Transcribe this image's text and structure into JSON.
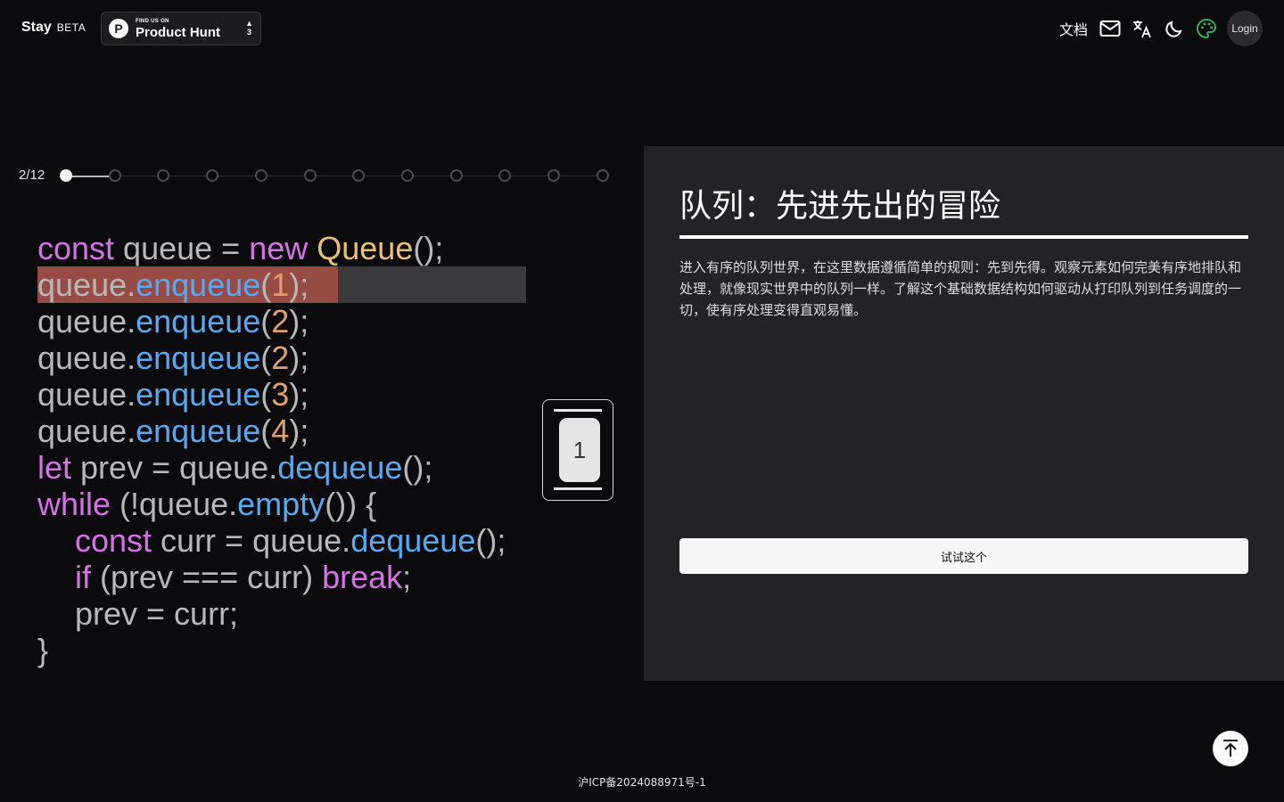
{
  "header": {
    "brand": "Stay",
    "beta": "BETA",
    "product_hunt": {
      "small": "FIND US ON",
      "big": "Product Hunt",
      "votes": "3"
    },
    "nav": {
      "docs": "文档",
      "login": "Login"
    }
  },
  "progress": {
    "label": "2/12",
    "current": 2,
    "total": 12
  },
  "code": {
    "lines": [
      [
        {
          "t": "const",
          "c": "kw"
        },
        {
          "t": " queue = ",
          "c": ""
        },
        {
          "t": "new",
          "c": "kw"
        },
        {
          "t": " ",
          "c": ""
        },
        {
          "t": "Queue",
          "c": "cls"
        },
        {
          "t": "();",
          "c": ""
        }
      ],
      [
        {
          "t": "queue.",
          "c": ""
        },
        {
          "t": "enqueue",
          "c": "fn"
        },
        {
          "t": "(",
          "c": ""
        },
        {
          "t": "1",
          "c": "num"
        },
        {
          "t": ");",
          "c": ""
        }
      ],
      [
        {
          "t": "queue.",
          "c": ""
        },
        {
          "t": "enqueue",
          "c": "fn"
        },
        {
          "t": "(",
          "c": ""
        },
        {
          "t": "2",
          "c": "num"
        },
        {
          "t": ");",
          "c": ""
        }
      ],
      [
        {
          "t": "queue.",
          "c": ""
        },
        {
          "t": "enqueue",
          "c": "fn"
        },
        {
          "t": "(",
          "c": ""
        },
        {
          "t": "2",
          "c": "num"
        },
        {
          "t": ");",
          "c": ""
        }
      ],
      [
        {
          "t": "queue.",
          "c": ""
        },
        {
          "t": "enqueue",
          "c": "fn"
        },
        {
          "t": "(",
          "c": ""
        },
        {
          "t": "3",
          "c": "num"
        },
        {
          "t": ");",
          "c": ""
        }
      ],
      [
        {
          "t": "queue.",
          "c": ""
        },
        {
          "t": "enqueue",
          "c": "fn"
        },
        {
          "t": "(",
          "c": ""
        },
        {
          "t": "4",
          "c": "num"
        },
        {
          "t": ");",
          "c": ""
        }
      ],
      [
        {
          "t": "let",
          "c": "kw"
        },
        {
          "t": " prev = queue.",
          "c": ""
        },
        {
          "t": "dequeue",
          "c": "fn"
        },
        {
          "t": "();",
          "c": ""
        }
      ],
      [
        {
          "t": "while",
          "c": "kw"
        },
        {
          "t": " (!queue.",
          "c": ""
        },
        {
          "t": "empty",
          "c": "fn"
        },
        {
          "t": "()) {",
          "c": ""
        }
      ],
      [
        {
          "t": "const",
          "c": "kw"
        },
        {
          "t": " curr = queue.",
          "c": ""
        },
        {
          "t": "dequeue",
          "c": "fn"
        },
        {
          "t": "();",
          "c": ""
        }
      ],
      [
        {
          "t": "if",
          "c": "kw"
        },
        {
          "t": " (prev === curr) ",
          "c": ""
        },
        {
          "t": "break",
          "c": "kw"
        },
        {
          "t": ";",
          "c": ""
        }
      ],
      [
        {
          "t": "prev = curr;",
          "c": ""
        }
      ],
      [
        {
          "t": "}",
          "c": ""
        }
      ]
    ],
    "indented": [
      8,
      9,
      10
    ],
    "highlighted_line": 1
  },
  "queue_widget": {
    "items": [
      "1"
    ]
  },
  "panel": {
    "title": "队列：先进先出的冒险",
    "description": "进入有序的队列世界，在这里数据遵循简单的规则：先到先得。观察元素如何完美有序地排队和处理，就像现实世界中的队列一样。了解这个基础数据结构如何驱动从打印队列到任务调度的一切，使有序处理变得直观易懂。",
    "try_button": "试试这个"
  },
  "footer": {
    "icp": "沪ICP备2024088971号-1"
  },
  "colors": {
    "keyword": "#d573e6",
    "function": "#5aa9f0",
    "class": "#e8c178",
    "number": "#e0a06a",
    "highlight": "#a94d45",
    "palette_icon": "#22c55e"
  }
}
